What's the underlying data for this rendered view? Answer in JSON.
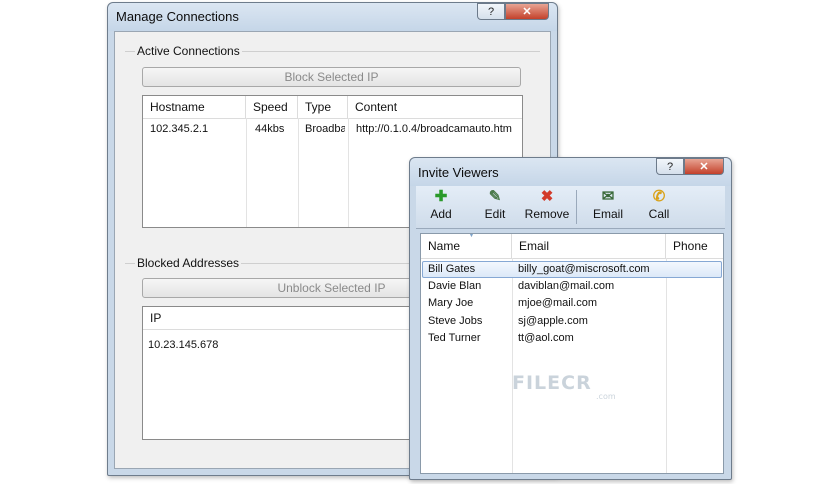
{
  "manage": {
    "title": "Manage Connections",
    "help_label": "?",
    "close_label": "✕",
    "active": {
      "label": "Active Connections",
      "block_button": "Block Selected IP",
      "columns": [
        "Hostname",
        "Speed",
        "Type",
        "Content"
      ],
      "rows": [
        [
          "102.345.2.1",
          "44kbs",
          "Broadba",
          "http://0.1.0.4/broadcamauto.htm"
        ]
      ]
    },
    "blocked": {
      "label": "Blocked Addresses",
      "unblock_button": "Unblock Selected IP",
      "columns": [
        "IP"
      ],
      "rows": [
        [
          "10.23.145.678"
        ]
      ]
    }
  },
  "invite": {
    "title": "Invite Viewers",
    "help_label": "?",
    "close_label": "✕",
    "toolbar": [
      {
        "label": "Add",
        "icon": "plus-icon",
        "color": "#2a9a2a"
      },
      {
        "label": "Edit",
        "icon": "edit-person-icon",
        "color": "#4a7a4a"
      },
      {
        "label": "Remove",
        "icon": "remove-x-icon",
        "color": "#d23a2a"
      },
      {
        "label": "Email",
        "icon": "email-person-icon",
        "color": "#3a6a3a"
      },
      {
        "label": "Call",
        "icon": "phone-icon",
        "color": "#d9a21a"
      }
    ],
    "columns": [
      "Name",
      "Email",
      "Phone"
    ],
    "rows": [
      [
        "Bill Gates",
        "billy_goat@miscrosoft.com",
        ""
      ],
      [
        "Davie Blan",
        "daviblan@mail.com",
        ""
      ],
      [
        "Mary Joe",
        "mjoe@mail.com",
        ""
      ],
      [
        "Steve Jobs",
        "sj@apple.com",
        ""
      ],
      [
        "Ted Turner",
        "tt@aol.com",
        ""
      ]
    ],
    "selected_row": 0
  },
  "watermark": {
    "text": "FILECR",
    "suffix": ".com"
  }
}
